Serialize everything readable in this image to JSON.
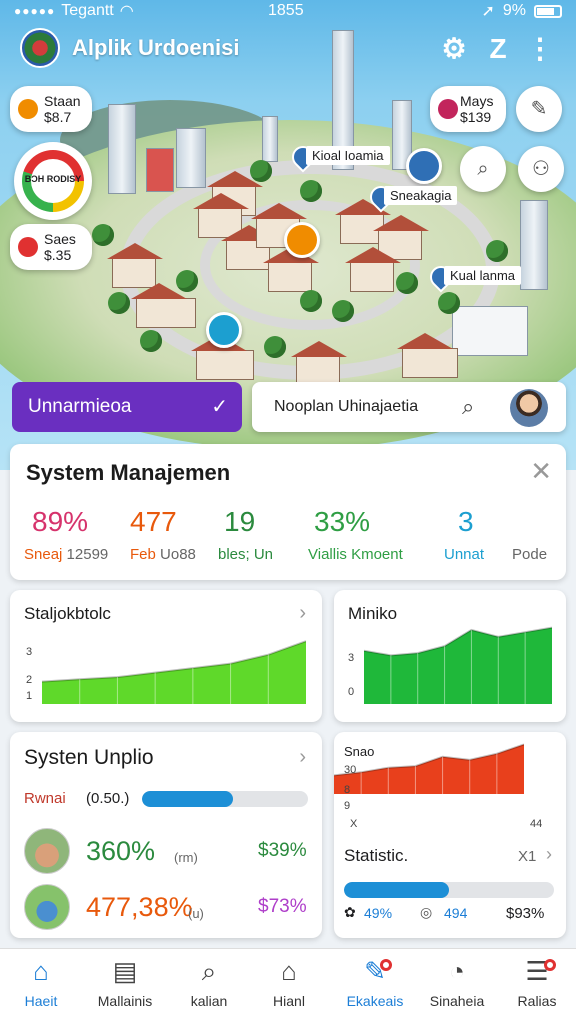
{
  "status_bar": {
    "carrier": "Tegantt",
    "time": "1855",
    "battery": "9%"
  },
  "app": {
    "title": "Alplik Urdoenisi"
  },
  "map": {
    "pill_top": {
      "label": "Staan",
      "value": "$8.7",
      "color": "#f08c00"
    },
    "gauge_label": "BƆH RODISY",
    "pill_bottom": {
      "label": "Saes",
      "value": "$.35",
      "color": "#e03131"
    },
    "pill_right": {
      "label": "Mays",
      "value": "$139",
      "color": "#c2255c"
    },
    "labels": [
      "Kioal Ioamia",
      "Sneakagia",
      "Kual lanma"
    ],
    "action_button": "Unnarmieoa",
    "search_text": "Nooplan Uhinajaetia"
  },
  "system": {
    "title": "System Manajemen",
    "stats": [
      {
        "value": "89%",
        "label": "Sneaj",
        "extra": "12599",
        "color": "#d6336c"
      },
      {
        "value": "477",
        "label": "Feb",
        "extra": "Uo88",
        "color": "#e8590c"
      },
      {
        "value": "19",
        "label": "bles; Un",
        "extra": "",
        "color": "#2b8a3e"
      },
      {
        "value": "33%",
        "label": "Viallis Kmoent",
        "extra": "",
        "color": "#2f9e44"
      },
      {
        "value": "3",
        "label": "Unnat",
        "extra": "",
        "color": "#1c9fd0"
      },
      {
        "value": "",
        "label": "Pode",
        "extra": "",
        "color": "#666666"
      }
    ]
  },
  "cards": {
    "left_chart": {
      "title": "Staljokbtolc",
      "ticks": [
        "3",
        "2",
        "1"
      ]
    },
    "right_chart": {
      "title": "Miniko",
      "ticks": [
        "3",
        "0"
      ]
    },
    "update": {
      "title": "Systen Unplio",
      "progress_label": "Rwnai",
      "progress_value": "(0.50.)",
      "progress": 0.55,
      "rows": [
        {
          "value": "360%",
          "unit": "(rm)",
          "price": "$39%"
        },
        {
          "value": "477,38%",
          "unit": "(u)",
          "price": "$73%"
        }
      ]
    },
    "small": {
      "title": "Snao",
      "ticks": [
        "30",
        "8",
        "9",
        "X"
      ],
      "end_tick": "44",
      "stat_title": "Statistic.",
      "stat_mult": "X1",
      "progress": 0.5,
      "foot": [
        "49%",
        "494",
        "$93%"
      ]
    }
  },
  "chart_data": [
    {
      "type": "area",
      "title": "Staljokbtolc",
      "y": [
        1,
        1.1,
        1.2,
        1.4,
        1.6,
        1.8,
        2.2,
        2.8
      ],
      "ylim": [
        0,
        3.3
      ],
      "color": "#5fd92a"
    },
    {
      "type": "area",
      "title": "Miniko",
      "y": [
        2.3,
        2.1,
        2.2,
        2.5,
        3.2,
        2.9,
        3.1,
        3.3
      ],
      "ylim": [
        0,
        3.8
      ],
      "color": "#1fb83a"
    },
    {
      "type": "area",
      "title": "Snao",
      "y": [
        12,
        14,
        17,
        18,
        24,
        22,
        26,
        32
      ],
      "ylim": [
        0,
        40
      ],
      "color": "#e8401c"
    }
  ],
  "nav": [
    {
      "label": "Haeit",
      "icon": "home-icon",
      "active": true
    },
    {
      "label": "Mallainis",
      "icon": "clipboard-icon"
    },
    {
      "label": "kalian",
      "icon": "search-icon"
    },
    {
      "label": "Hianl",
      "icon": "house-icon"
    },
    {
      "label": "Ekakeais",
      "icon": "edit-icon",
      "badge": true
    },
    {
      "label": "Sinaheia",
      "icon": "gauge-icon"
    },
    {
      "label": "Ralias",
      "icon": "menu-icon",
      "badge": true
    }
  ],
  "colors": {
    "accent": "#1d8fd6",
    "purple": "#6a2fc0",
    "active_nav": "#1c7ed6"
  }
}
